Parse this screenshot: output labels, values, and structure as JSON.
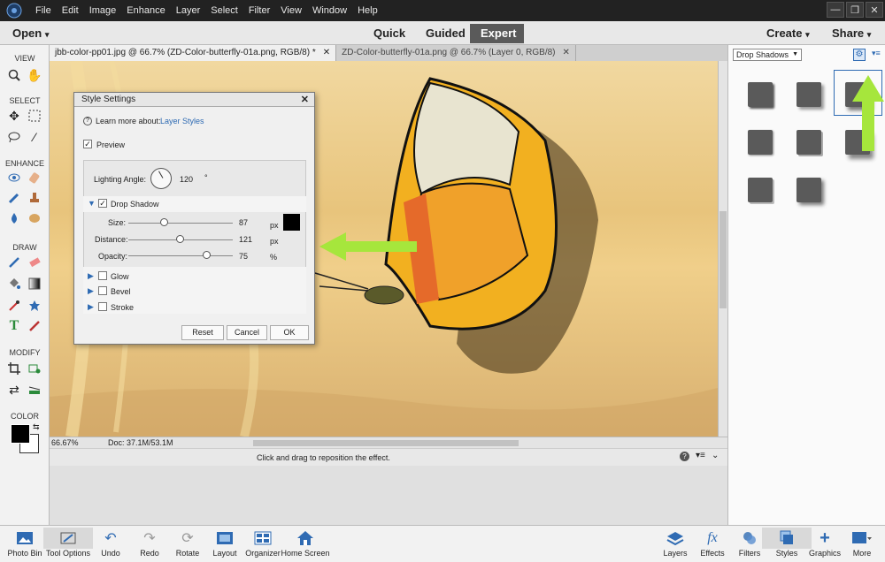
{
  "menu": [
    "File",
    "Edit",
    "Image",
    "Enhance",
    "Layer",
    "Select",
    "Filter",
    "View",
    "Window",
    "Help"
  ],
  "window_buttons": [
    "—",
    "❐",
    "✕"
  ],
  "modebar": {
    "open": "Open",
    "modes": [
      "Quick",
      "Guided",
      "Expert"
    ],
    "create": "Create",
    "share": "Share"
  },
  "tabs": [
    {
      "label": "jbb-color-pp01.jpg @ 66.7% (ZD-Color-butterfly-01a.png, RGB/8) *",
      "close": "✕"
    },
    {
      "label": "ZD-Color-butterfly-01a.png @ 66.7% (Layer 0, RGB/8)",
      "close": "✕"
    }
  ],
  "toolbar": {
    "view": "VIEW",
    "select": "SELECT",
    "enhance": "ENHANCE",
    "draw": "DRAW",
    "modify": "MODIFY",
    "color": "COLOR",
    "text_tool": "T"
  },
  "dialog": {
    "title": "Style Settings",
    "learn": "Learn more about:",
    "learn_link": "Layer Styles",
    "preview": "Preview",
    "lighting_label": "Lighting Angle:",
    "lighting_value": "120",
    "degree": "°",
    "drop_shadow": "Drop Shadow",
    "size_label": "Size:",
    "size_value": "87",
    "size_unit": "px",
    "distance_label": "Distance:",
    "distance_value": "121",
    "distance_unit": "px",
    "opacity_label": "Opacity:",
    "opacity_value": "75",
    "opacity_unit": "%",
    "glow": "Glow",
    "bevel": "Bevel",
    "stroke": "Stroke",
    "reset": "Reset",
    "cancel": "Cancel",
    "ok": "OK",
    "size_frac": 0.35,
    "distance_frac": 0.5,
    "opacity_frac": 0.75
  },
  "status": {
    "zoom": "66.67%",
    "doc": "Doc: 37.1M/53.1M"
  },
  "hint": "Click and drag to reposition the effect.",
  "rightpanel": {
    "dropdown": "Drop Shadows"
  },
  "bottom_left": [
    {
      "label": "Photo Bin",
      "icon": "photo-bin-icon"
    },
    {
      "label": "Tool Options",
      "icon": "tool-options-icon"
    },
    {
      "label": "Undo",
      "icon": "undo-icon"
    },
    {
      "label": "Redo",
      "icon": "redo-icon"
    },
    {
      "label": "Rotate",
      "icon": "rotate-icon"
    },
    {
      "label": "Layout",
      "icon": "layout-icon"
    },
    {
      "label": "Organizer",
      "icon": "organizer-icon"
    },
    {
      "label": "Home Screen",
      "icon": "home-icon"
    }
  ],
  "bottom_right": [
    {
      "label": "Layers",
      "icon": "layers-icon"
    },
    {
      "label": "Effects",
      "icon": "fx-icon",
      "glyph": "fx"
    },
    {
      "label": "Filters",
      "icon": "filters-icon"
    },
    {
      "label": "Styles",
      "icon": "styles-icon"
    },
    {
      "label": "Graphics",
      "icon": "graphics-icon",
      "glyph": "+"
    },
    {
      "label": "More",
      "icon": "more-icon"
    }
  ],
  "colors": {
    "accent": "#2f6bb3",
    "arrow": "#a6e63c",
    "menubar": "#222222"
  }
}
